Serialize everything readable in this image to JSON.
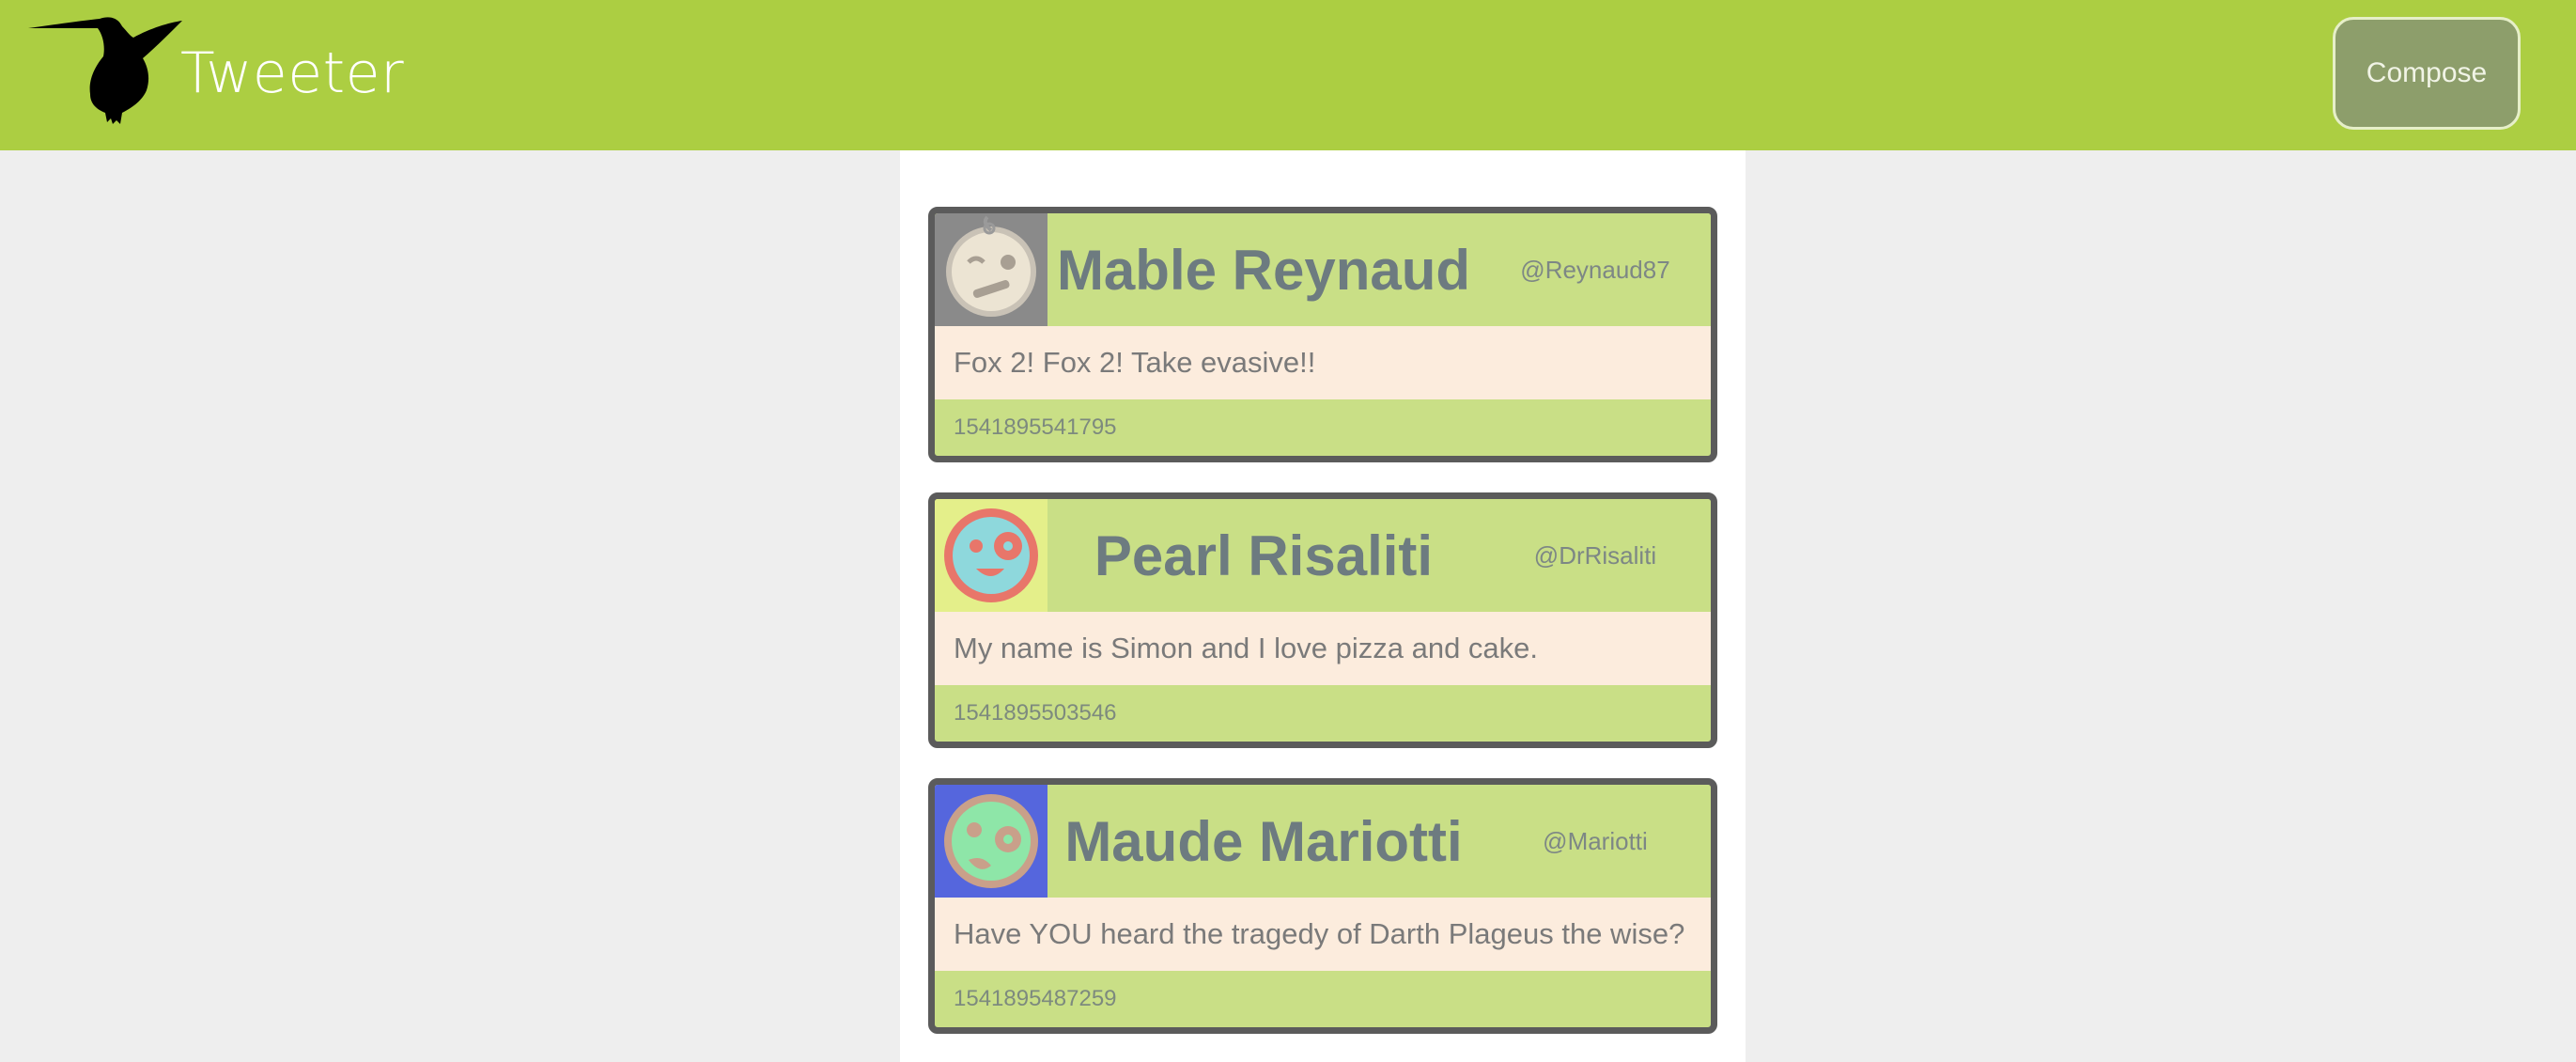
{
  "header": {
    "brand": "Tweeter",
    "logo_icon": "hummingbird-icon",
    "compose_label": "Compose",
    "bar_color": "#acce42"
  },
  "tweets": [
    {
      "name": "Mable Reynaud",
      "handle": "@Reynaud87",
      "text": "Fox 2! Fox 2! Take evasive!!",
      "timestamp": "1541895541795",
      "avatar_icon": "winking-face-avatar-icon",
      "avatar_bg": "#8a8a8a"
    },
    {
      "name": "Pearl Risaliti",
      "handle": "@DrRisaliti",
      "text": "My name is Simon and I love pizza and cake.",
      "timestamp": "1541895503546",
      "avatar_icon": "winking-smile-avatar-icon",
      "avatar_bg": "#e4ef8a"
    },
    {
      "name": "Maude Mariotti",
      "handle": "@Mariotti",
      "text": "Have YOU heard the tragedy of Darth Plageus the wise?",
      "timestamp": "1541895487259",
      "avatar_icon": "grimacing-face-avatar-icon",
      "avatar_bg": "#5566dd"
    }
  ]
}
